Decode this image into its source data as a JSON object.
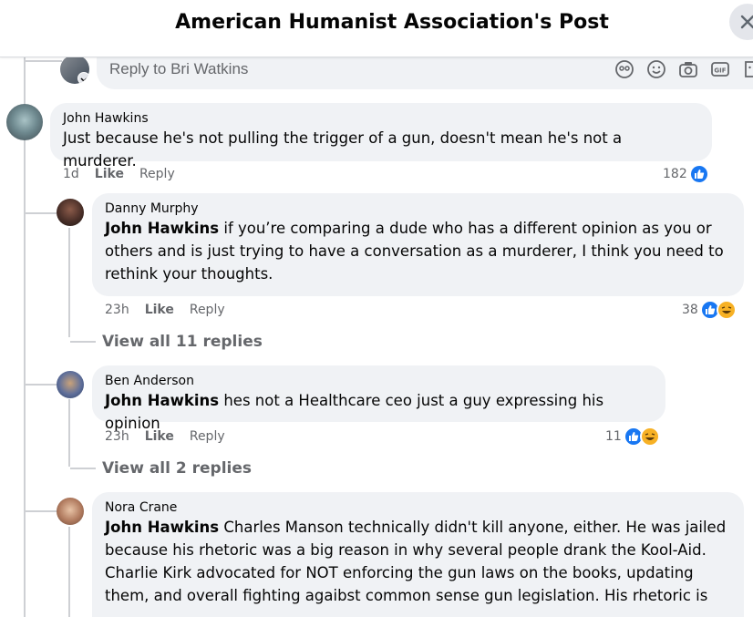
{
  "header": {
    "title": "American Humanist Association's Post"
  },
  "composer": {
    "placeholder": "Reply to Bri Watkins"
  },
  "comments": [
    {
      "author": "John Hawkins",
      "mention": "",
      "text": "Just because he's not pulling the trigger of a gun, doesn't mean he's not a murderer.",
      "time": "1d",
      "like": "Like",
      "reply": "Reply",
      "reactions": "182"
    },
    {
      "author": "Danny Murphy",
      "mention": "John Hawkins",
      "text": " if you’re comparing a dude who has a different opinion as you or others and is just trying to have a conversation as a murderer, I think you need to rethink your thoughts.",
      "time": "23h",
      "like": "Like",
      "reply": "Reply",
      "reactions": "38",
      "view_all": "View all 11 replies"
    },
    {
      "author": "Ben Anderson",
      "mention": "John Hawkins",
      "text": " hes not a Healthcare ceo just a guy expressing his opinion",
      "time": "23h",
      "like": "Like",
      "reply": "Reply",
      "reactions": "11",
      "view_all": "View all 2 replies"
    },
    {
      "author": "Nora Crane",
      "mention": "John Hawkins",
      "text": " Charles Manson technically didn't kill anyone, either. He was jailed because his rhetoric was a big reason in why several people drank the Kool-Aid. Charlie Kirk advocated for NOT enforcing the gun laws on the books, updating them, and overall fighting agaibst common sense gun legislation. His rhetoric is"
    }
  ],
  "colors": {
    "like_blue": "#1877f2",
    "haha_yellow": "#f7b125",
    "bubble_bg": "#f0f2f5",
    "meta_gray": "#65676b"
  },
  "icons": [
    "close-icon",
    "avatar-icon",
    "gif-icon",
    "camera-icon",
    "emoji-icon",
    "sticker-icon",
    "like-reaction-icon",
    "haha-reaction-icon"
  ]
}
